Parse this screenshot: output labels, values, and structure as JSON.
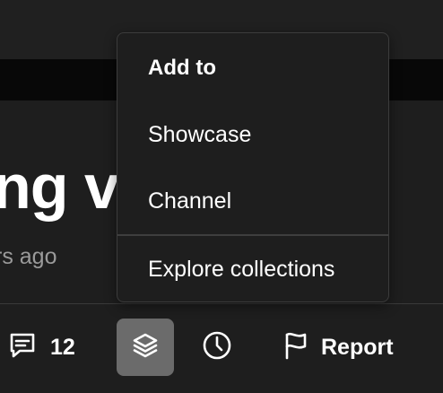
{
  "video": {
    "title_fragment": "ng vi",
    "meta_fragment": "rs ago"
  },
  "actions": {
    "comments_count": "12",
    "report_label": "Report",
    "icons": {
      "comments": "comment-bubble-icon",
      "collections": "stacked-layers-icon",
      "watch_later": "clock-icon",
      "report": "flag-icon"
    }
  },
  "add_to_menu": {
    "header": "Add to",
    "items": [
      "Showcase",
      "Channel"
    ],
    "explore_label": "Explore collections"
  },
  "colors": {
    "background": "#1e1e1e",
    "active_button": "#6b6b6b",
    "muted_text": "#9a9a9a",
    "divider": "#3e3e3e"
  }
}
